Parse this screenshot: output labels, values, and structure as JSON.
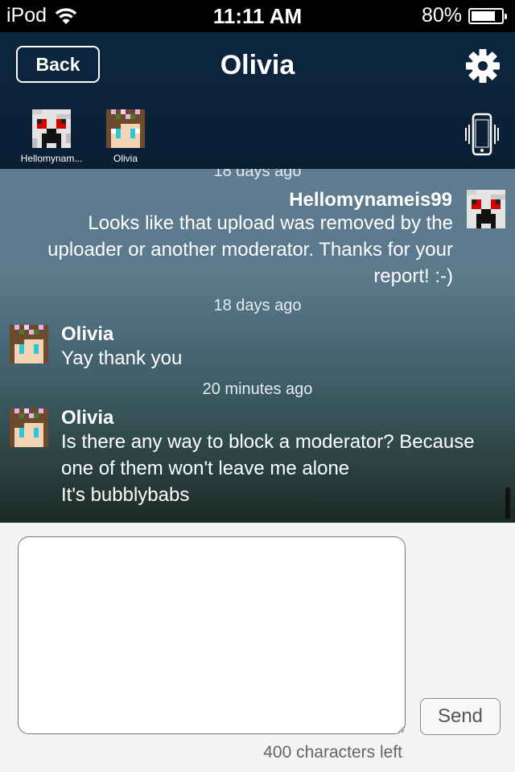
{
  "status_bar": {
    "device": "iPod",
    "time": "11:11 AM",
    "battery": "80%",
    "battery_level": 0.8
  },
  "nav": {
    "back_label": "Back",
    "title": "Olivia",
    "settings_icon": "gear-icon",
    "vibrate_icon": "phone-vibrate-icon",
    "participants": [
      {
        "name": "Hellomynam...",
        "avatar": "creeper-avatar"
      },
      {
        "name": "Olivia",
        "avatar": "flower-girl-avatar"
      }
    ]
  },
  "chat": {
    "messages": [
      {
        "timestamp": "18 days ago",
        "sender": "Hellomynameis99",
        "lines": [
          "Looks like that upload was removed by the",
          "uploader or another moderator. Thanks for your",
          "report! :-)"
        ]
      },
      {
        "timestamp": "18 days ago",
        "sender": "Olivia",
        "lines": [
          "Yay thank you"
        ]
      },
      {
        "timestamp": "20 minutes ago",
        "sender": "Olivia",
        "lines": [
          "Is there any way to block a moderator? Because",
          "one of them won't leave me alone",
          "It's bubblybabs"
        ]
      }
    ]
  },
  "compose": {
    "value": "",
    "send_label": "Send",
    "chars_left": "400 characters left"
  }
}
